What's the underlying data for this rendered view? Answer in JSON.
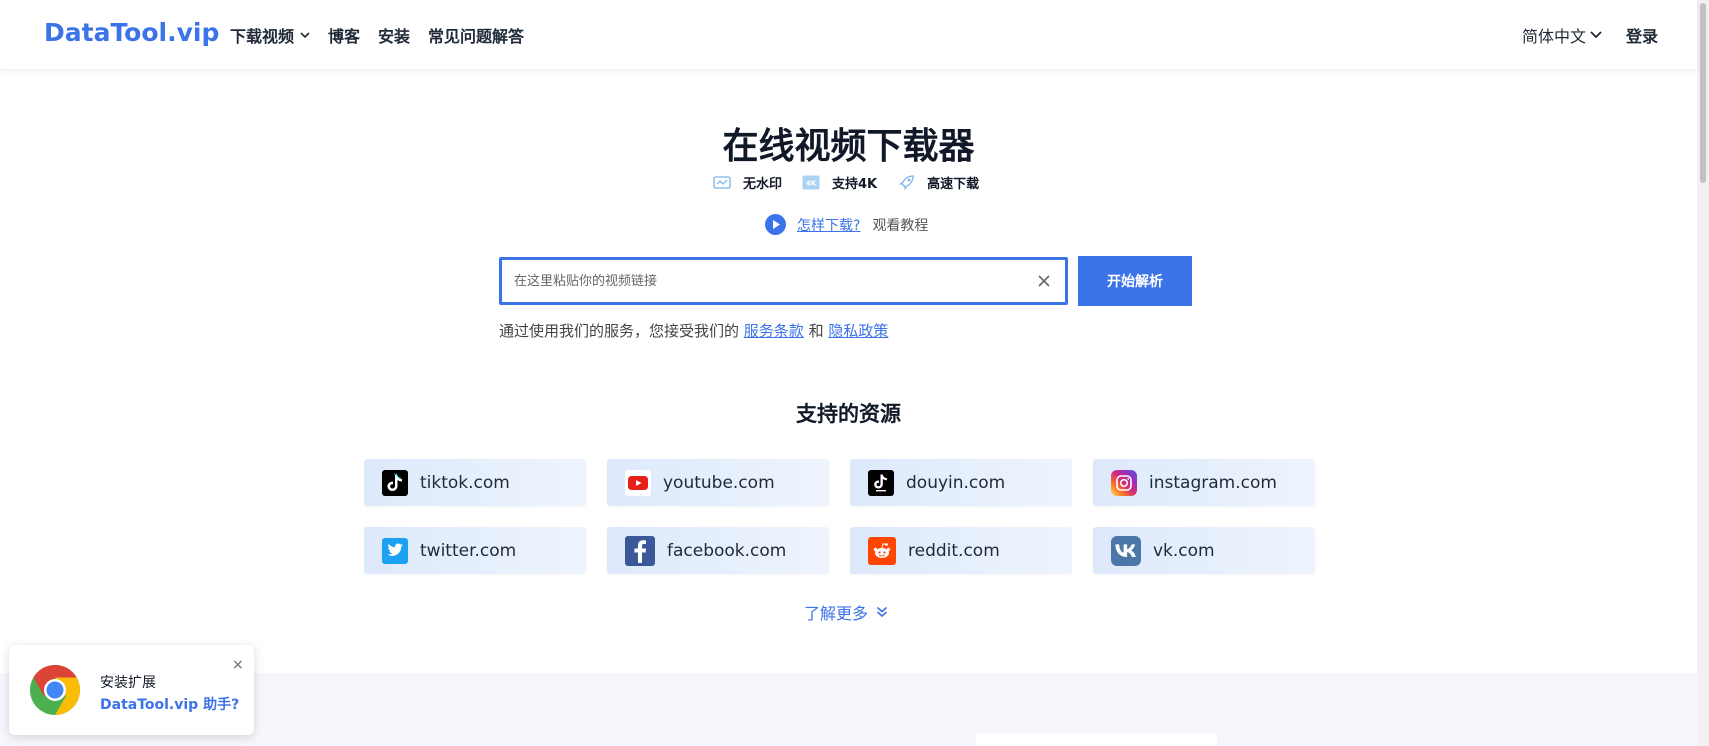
{
  "header": {
    "logo": "DataTool.vip",
    "nav": [
      {
        "label": "下载视频",
        "has_dropdown": true
      },
      {
        "label": "博客"
      },
      {
        "label": "安装"
      },
      {
        "label": "常见问题解答"
      }
    ],
    "language": "简体中文",
    "login": "登录"
  },
  "hero": {
    "title": "在线视频下载器",
    "features": [
      {
        "icon": "no-watermark-icon",
        "label": "无水印"
      },
      {
        "icon": "4k-icon",
        "label": "支持4K"
      },
      {
        "icon": "rocket-icon",
        "label": "高速下载"
      }
    ],
    "howto_link": "怎样下载?",
    "howto_text": "观看教程",
    "search_placeholder": "在这里粘贴你的视频链接",
    "search_value": "",
    "parse_button": "开始解析",
    "terms_prefix": "通过使用我们的服务，您接受我们的",
    "terms_link": "服务条款",
    "terms_and": "和",
    "privacy_link": "隐私政策"
  },
  "sources": {
    "title": "支持的资源",
    "items": [
      {
        "label": "tiktok.com",
        "icon": "tiktok-icon"
      },
      {
        "label": "youtube.com",
        "icon": "youtube-icon"
      },
      {
        "label": "douyin.com",
        "icon": "douyin-icon"
      },
      {
        "label": "instagram.com",
        "icon": "instagram-icon"
      },
      {
        "label": "twitter.com",
        "icon": "twitter-icon"
      },
      {
        "label": "facebook.com",
        "icon": "facebook-icon"
      },
      {
        "label": "reddit.com",
        "icon": "reddit-icon"
      },
      {
        "label": "vk.com",
        "icon": "vk-icon"
      }
    ],
    "more": "了解更多"
  },
  "popup": {
    "line1": "安装扩展",
    "line2": "DataTool.vip 助手?",
    "close": "×"
  },
  "colors": {
    "accent": "#3b73e8",
    "youtube": "#e62117",
    "twitter": "#1da1f2",
    "facebook": "#3b5998",
    "reddit": "#ff4500",
    "vk": "#4a76a8"
  }
}
